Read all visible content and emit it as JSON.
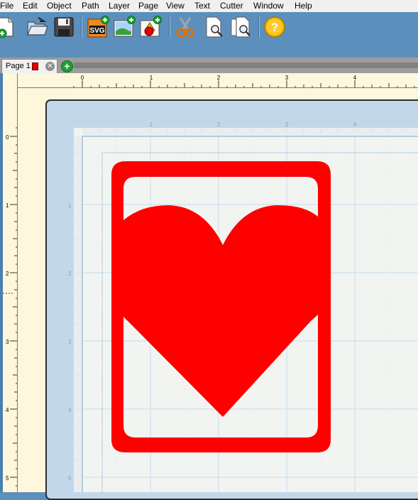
{
  "menu": {
    "items": [
      "File",
      "Edit",
      "Object",
      "Path",
      "Layer",
      "Page",
      "View",
      "Text",
      "Cutter",
      "Window",
      "Help"
    ]
  },
  "toolbar": {
    "buttons": [
      {
        "icon": "new-document-icon"
      },
      {
        "icon": "open-folder-icon"
      },
      {
        "icon": "save-disk-icon"
      },
      {
        "icon": "import-svg-icon",
        "label": "SVG"
      },
      {
        "icon": "import-image-icon"
      },
      {
        "icon": "add-shape-icon"
      },
      {
        "icon": "cut-scissors-icon"
      },
      {
        "icon": "preview-page-icon"
      },
      {
        "icon": "preview-pages-icon"
      },
      {
        "icon": "help-icon",
        "label": "?"
      }
    ]
  },
  "tabs": [
    {
      "label": "Page 1",
      "swatch_color": "#e00000"
    }
  ],
  "rulers": {
    "horizontal_labels": [
      "0",
      "1",
      "2",
      "3",
      "4"
    ],
    "vertical_labels": [
      "0",
      "1",
      "2",
      "3",
      "4",
      "5"
    ],
    "mat_top_labels": [
      "1",
      "2",
      "3",
      "4"
    ],
    "mat_left_labels": [
      "1",
      "2",
      "3",
      "4",
      "5"
    ]
  },
  "canvas": {
    "shape_color": "#ff0000",
    "mat_color": "#c2d8ea",
    "paper_color": "#f2f4f1",
    "ruler_color": "#fff7dc"
  }
}
